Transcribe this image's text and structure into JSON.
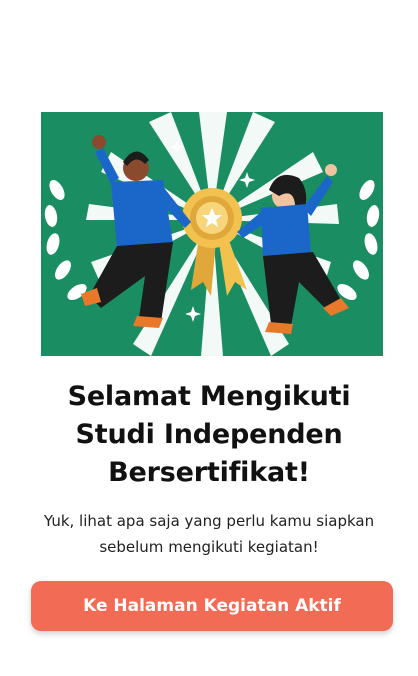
{
  "illustration": {
    "icon": "certificate-celebration-illustration",
    "background_color": "#1a8d63",
    "ray_color": "#ffffff",
    "medal_color": "#f2c14e"
  },
  "heading": {
    "line1": "Selamat Mengikuti",
    "line2": "Studi Independen",
    "line3": "Bersertifikat!"
  },
  "description": {
    "line1": "Yuk, lihat apa saja yang perlu kamu siapkan",
    "line2": "sebelum mengikuti kegiatan!"
  },
  "cta": {
    "label": "Ke Halaman Kegiatan Aktif",
    "color": "#f26b55"
  }
}
